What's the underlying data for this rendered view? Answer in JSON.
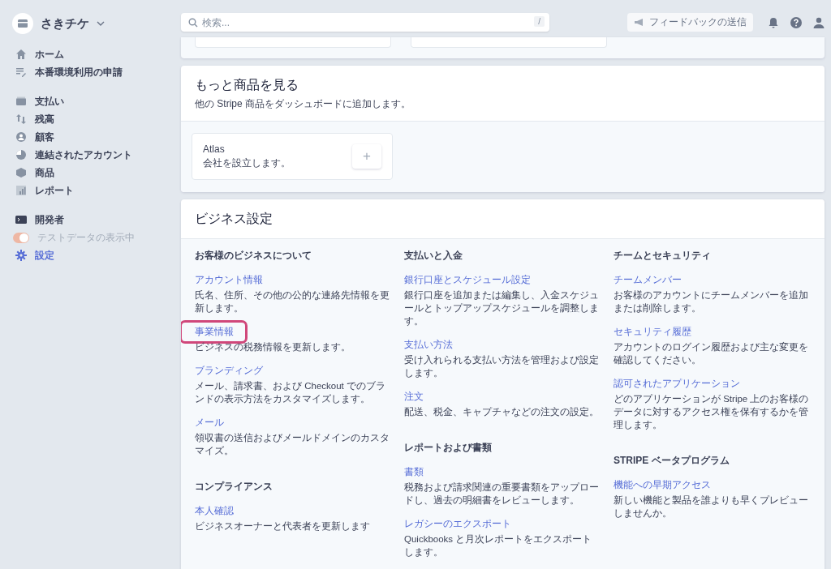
{
  "account": {
    "name": "さきチケ"
  },
  "sidebar": {
    "sections": [
      [
        {
          "label": "ホーム",
          "kind": "link",
          "selected": false
        },
        {
          "label": "本番環境利用の申請",
          "kind": "link",
          "selected": false
        }
      ],
      [
        {
          "label": "支払い",
          "kind": "link",
          "selected": false
        },
        {
          "label": "残高",
          "kind": "link",
          "selected": false
        },
        {
          "label": "顧客",
          "kind": "link",
          "selected": false
        },
        {
          "label": "連結されたアカウント",
          "kind": "link",
          "selected": false
        },
        {
          "label": "商品",
          "kind": "link",
          "selected": false
        },
        {
          "label": "レポート",
          "kind": "link",
          "selected": false
        }
      ],
      [
        {
          "label": "開発者",
          "kind": "link",
          "selected": false
        },
        {
          "label": "テストデータの表示中",
          "kind": "toggle",
          "on": true,
          "disabled": true
        },
        {
          "label": "設定",
          "kind": "link",
          "selected": true
        }
      ]
    ]
  },
  "search": {
    "placeholder": "検索...",
    "shortcut": "/"
  },
  "feedback_button": "フィードバックの送信",
  "more_products": {
    "title": "もっと商品を見る",
    "subtitle": "他の Stripe 商品をダッシュボードに追加します。",
    "products": [
      {
        "name": "Atlas",
        "description": "会社を設立します。",
        "add": "+"
      }
    ]
  },
  "business_settings": {
    "title": "ビジネス設定",
    "columns": [
      {
        "groups": [
          {
            "heading": "お客様のビジネスについて",
            "links": [
              {
                "title": "アカウント情報",
                "description": "氏名、住所、その他の公的な連絡先情報を更新します。",
                "highlighted": false
              },
              {
                "title": "事業情報",
                "description": "ビジネスの税務情報を更新します。",
                "highlighted": true
              },
              {
                "title": "ブランディング",
                "description": "メール、請求書、および Checkout でのブランドの表示方法をカスタマイズします。",
                "highlighted": false
              },
              {
                "title": "メール",
                "description": "領収書の送信およびメールドメインのカスタマイズ。",
                "highlighted": false
              }
            ]
          },
          {
            "heading": "コンプライアンス",
            "links": [
              {
                "title": "本人確認",
                "description": "ビジネスオーナーと代表者を更新します",
                "highlighted": false
              }
            ]
          }
        ]
      },
      {
        "groups": [
          {
            "heading": "支払いと入金",
            "links": [
              {
                "title": "銀行口座とスケジュール設定",
                "description": "銀行口座を追加または編集し、入金スケジュールとトップアップスケジュールを調整します。",
                "highlighted": false
              },
              {
                "title": "支払い方法",
                "description": "受け入れられる支払い方法を管理および設定します。",
                "highlighted": false
              },
              {
                "title": "注文",
                "description": "配送、税金、キャプチャなどの注文の設定。",
                "highlighted": false
              }
            ]
          },
          {
            "heading": "レポートおよび書類",
            "links": [
              {
                "title": "書類",
                "description": "税務および請求関連の重要書類をアップロードし、過去の明細書をレビューします。",
                "highlighted": false
              },
              {
                "title": "レガシーのエクスポート",
                "description": "Quickbooks と月次レポートをエクスポートします。",
                "highlighted": false
              }
            ]
          }
        ]
      },
      {
        "groups": [
          {
            "heading": "チームとセキュリティ",
            "links": [
              {
                "title": "チームメンバー",
                "description": "お客様のアカウントにチームメンバーを追加または削除します。",
                "highlighted": false
              },
              {
                "title": "セキュリティ履歴",
                "description": "アカウントのログイン履歴および主な変更を確認してください。",
                "highlighted": false
              },
              {
                "title": "認可されたアプリケーション",
                "description": "どのアプリケーションが Stripe 上のお客様のデータに対するアクセス権を保有するかを管理します。",
                "highlighted": false
              }
            ]
          },
          {
            "heading": "STRIPE ベータプログラム",
            "links": [
              {
                "title": "機能への早期アクセス",
                "description": "新しい機能と製品を誰よりも早くプレビューしませんか。",
                "highlighted": false
              }
            ]
          }
        ]
      }
    ]
  }
}
